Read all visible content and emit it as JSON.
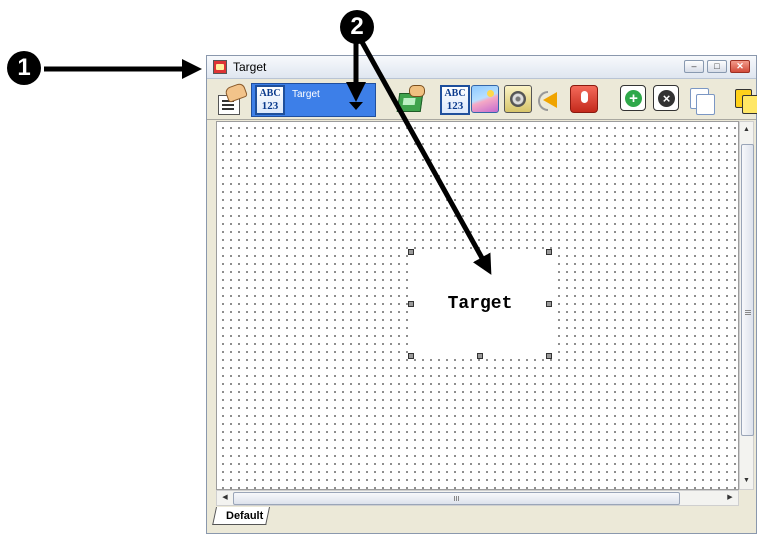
{
  "callouts": [
    "1",
    "2"
  ],
  "window": {
    "title": "Target",
    "controls": {
      "minimize": "–",
      "maximize": "□",
      "close": "✕"
    }
  },
  "toolbar": {
    "target_selector_label": "Target",
    "abc_line1": "ABC",
    "abc_line2": "123",
    "icons": [
      "properties-icon",
      "target-selector",
      "send-card-icon",
      "text-icon",
      "image-icon",
      "video-icon",
      "sound-icon",
      "record-icon",
      "add-card-icon",
      "delete-card-icon",
      "copy-icon",
      "paste-icon"
    ]
  },
  "canvas": {
    "object_text": "Target"
  },
  "tabs": [
    {
      "label": "Default"
    }
  ],
  "colors": {
    "selector_bg": "#3d7fe8",
    "close_button": "#d24b3a",
    "canvas_bg": "#ffffff",
    "window_bg": "#ece9d8"
  }
}
